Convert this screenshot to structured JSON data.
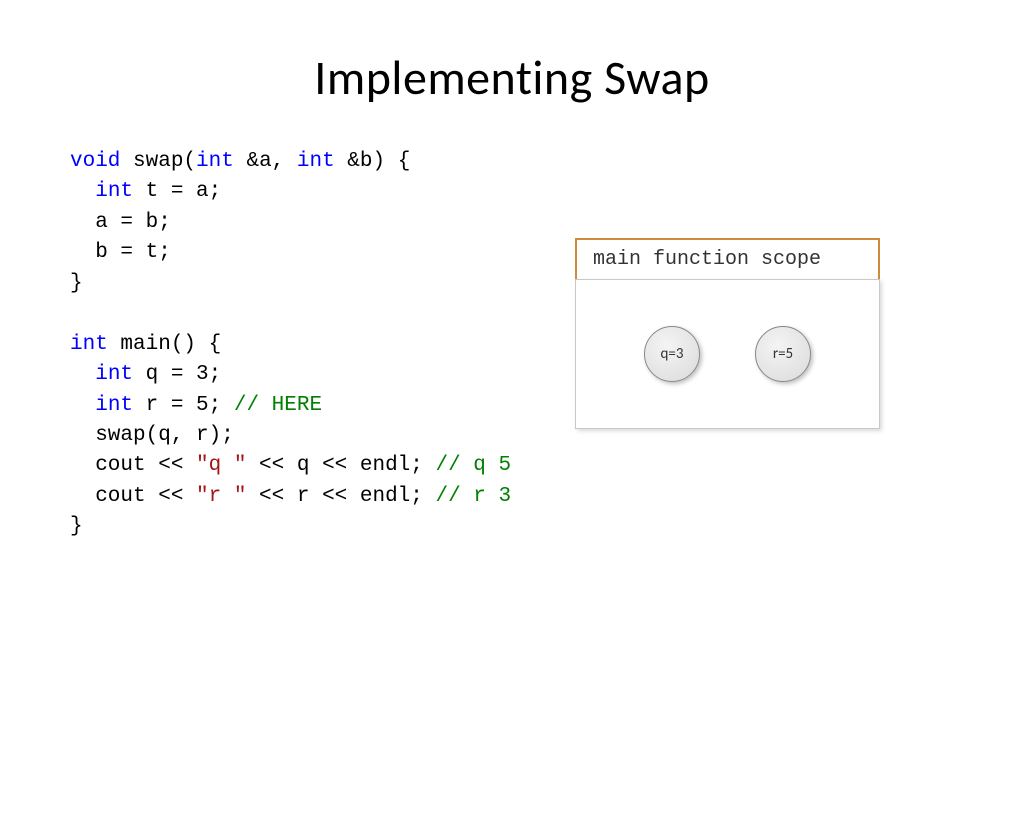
{
  "title": "Implementing Swap",
  "code": {
    "swap": {
      "sig_kw1": "void",
      "sig_name": " swap(",
      "sig_kw2": "int",
      "sig_ref1": " &a, ",
      "sig_kw3": "int",
      "sig_ref2": " &b) {",
      "line1_kw": "int",
      "line1_rest": " t = a;",
      "line2": "  a = b;",
      "line3": "  b = t;",
      "close": "}"
    },
    "main": {
      "sig_kw": "int",
      "sig_rest": " main() {",
      "q_kw": "int",
      "q_rest": " q = 3;",
      "r_kw": "int",
      "r_rest": " r = 5; ",
      "r_comment": "// HERE",
      "swap_call": "  swap(q, r);",
      "cout1_a": "  cout << ",
      "cout1_str": "\"q \"",
      "cout1_b": " << q << endl; ",
      "cout1_cm": "// q 5",
      "cout2_a": "  cout << ",
      "cout2_str": "\"r \"",
      "cout2_b": " << r << endl; ",
      "cout2_cm": "// r 3",
      "close": "}"
    }
  },
  "diagram": {
    "scope_label": "main function scope",
    "vars": {
      "q": "q=3",
      "r": "r=5"
    }
  }
}
